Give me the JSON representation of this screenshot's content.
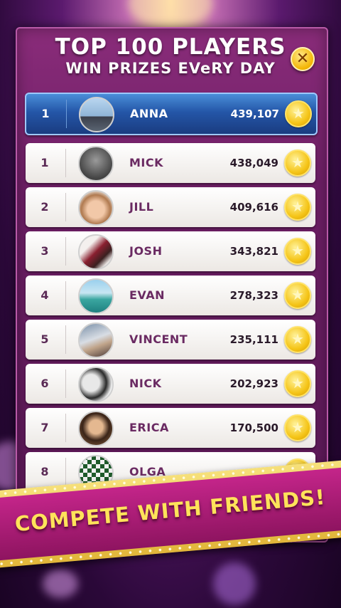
{
  "header": {
    "title": "TOP 100 PLAYERS",
    "subtitle": "WIN PRIZES EVeRY DAY",
    "close_label": "✕"
  },
  "current_player": {
    "rank": "1",
    "name": "ANNA",
    "score": "439,107"
  },
  "leaderboard": [
    {
      "rank": "1",
      "name": "MICK",
      "score": "438,049"
    },
    {
      "rank": "2",
      "name": "JILL",
      "score": "409,616"
    },
    {
      "rank": "3",
      "name": "JOSH",
      "score": "343,821"
    },
    {
      "rank": "4",
      "name": "EVAN",
      "score": "278,323"
    },
    {
      "rank": "5",
      "name": "VINCENT",
      "score": "235,111"
    },
    {
      "rank": "6",
      "name": "NICK",
      "score": "202,923"
    },
    {
      "rank": "7",
      "name": "ERICA",
      "score": "170,500"
    },
    {
      "rank": "8",
      "name": "OLGA",
      "score": ""
    }
  ],
  "banner": {
    "text": "COMPETE WITH FRIENDS!"
  },
  "icons": {
    "coin": "star-coin-icon",
    "close": "close-icon"
  },
  "colors": {
    "accent": "#f5c518",
    "panel": "#6e1f66",
    "highlight": "#2456a8",
    "banner": "#c4258a"
  }
}
